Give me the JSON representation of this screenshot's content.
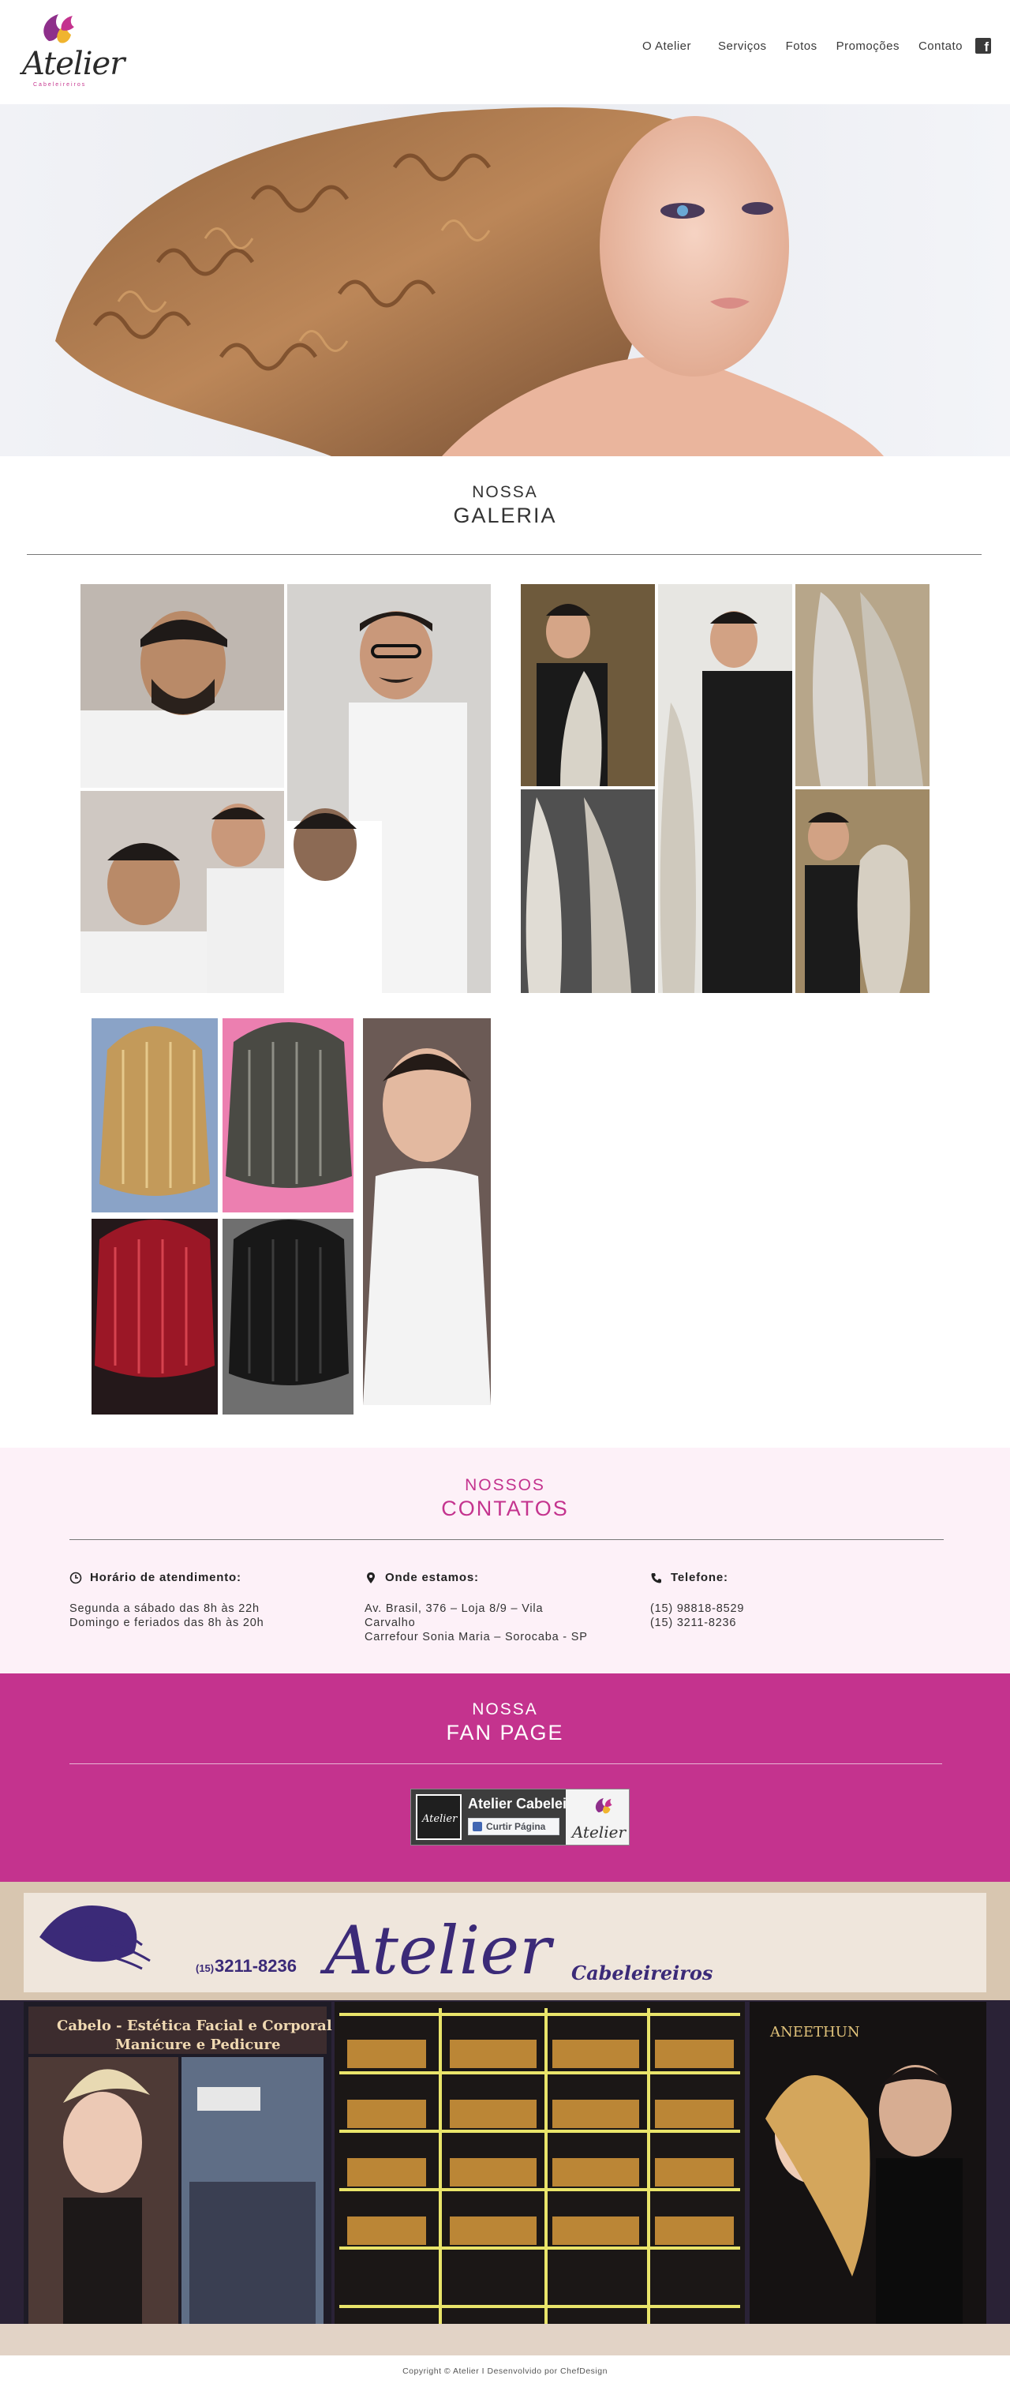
{
  "header": {
    "logo_text": "Atelier",
    "logo_sub": "Cabeleireiros",
    "nav": [
      "O Atelier",
      "Serviços",
      "Fotos",
      "Promoções",
      "Contato"
    ],
    "facebook_icon": "facebook-icon"
  },
  "gallery": {
    "small": "NOSSA",
    "large": "GALERIA"
  },
  "contacts": {
    "small": "NOSSOS",
    "large": "CONTATOS",
    "hours": {
      "icon": "clock-icon",
      "title": "Horário de atendimento:",
      "lines": [
        "Segunda a sábado das 8h às 22h",
        "Domingo e feriados das 8h às 20h"
      ]
    },
    "location": {
      "icon": "map-pin-icon",
      "title": "Onde estamos:",
      "lines": [
        "Av. Brasil, 376 – Loja 8/9 – Vila",
        "Carvalho",
        "Carrefour Sonia Maria – Sorocaba - SP"
      ]
    },
    "phone": {
      "icon": "phone-icon",
      "title": "Telefone:",
      "lines": [
        "(15) 98818-8529",
        "(15) 3211-8236"
      ]
    }
  },
  "fanpage": {
    "small": "NOSSA",
    "large": "FAN PAGE",
    "widget_name": "Atelier Cabeleirei...",
    "like_label": "Curtir Página",
    "widget_logo": "Atelier"
  },
  "storefront": {
    "phone_prefix": "(15)",
    "phone": "3211-8236",
    "brand": "Atelier",
    "brand_sub": "Cabeleireiros",
    "services_1": "Cabelo - Estética Facial e Corporal",
    "services_2": "Manicure e Pedicure",
    "partner": "ANEETHUN"
  },
  "footer": {
    "copyright": "Copyright © Atelier I Desenvolvido por ChefDesign"
  },
  "colors": {
    "brand_magenta": "#c4338e",
    "contacts_bg": "#fdf1f8"
  }
}
